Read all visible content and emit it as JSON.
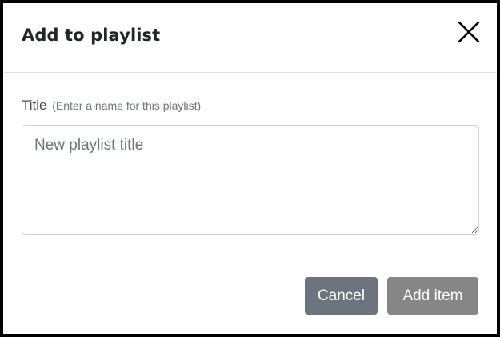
{
  "dialog": {
    "title": "Add to playlist",
    "close_icon": "close-icon"
  },
  "form": {
    "title_label": "Title",
    "title_hint": "(Enter a name for this playlist)",
    "title_placeholder": "New playlist title",
    "title_value": ""
  },
  "footer": {
    "cancel_label": "Cancel",
    "add_label": "Add item"
  },
  "colors": {
    "cancel_button": "#6c757d",
    "add_button_disabled": "#868686",
    "border": "#dee2e6"
  }
}
